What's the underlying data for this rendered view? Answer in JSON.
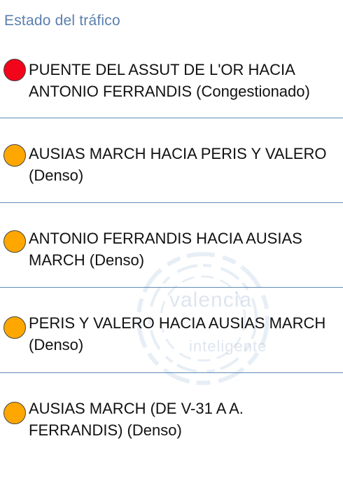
{
  "header": {
    "title": "Estado del tráfico"
  },
  "watermark": {
    "line1": "valencia",
    "line2": "inteligente"
  },
  "traffic": [
    {
      "text": "PUENTE DEL ASSUT DE L'OR HACIA ANTONIO FERRANDIS (Congestionado)",
      "status": "Congestionado",
      "color": "#f2041a"
    },
    {
      "text": "AUSIAS MARCH HACIA PERIS Y VALERO (Denso)",
      "status": "Denso",
      "color": "#ffa701"
    },
    {
      "text": "ANTONIO FERRANDIS HACIA AUSIAS MARCH (Denso)",
      "status": "Denso",
      "color": "#ffa701"
    },
    {
      "text": "PERIS Y VALERO HACIA AUSIAS MARCH (Denso)",
      "status": "Denso",
      "color": "#ffa701"
    },
    {
      "text": "AUSIAS MARCH (DE V-31 A A. FERRANDIS) (Denso)",
      "status": "Denso",
      "color": "#ffa701"
    }
  ]
}
